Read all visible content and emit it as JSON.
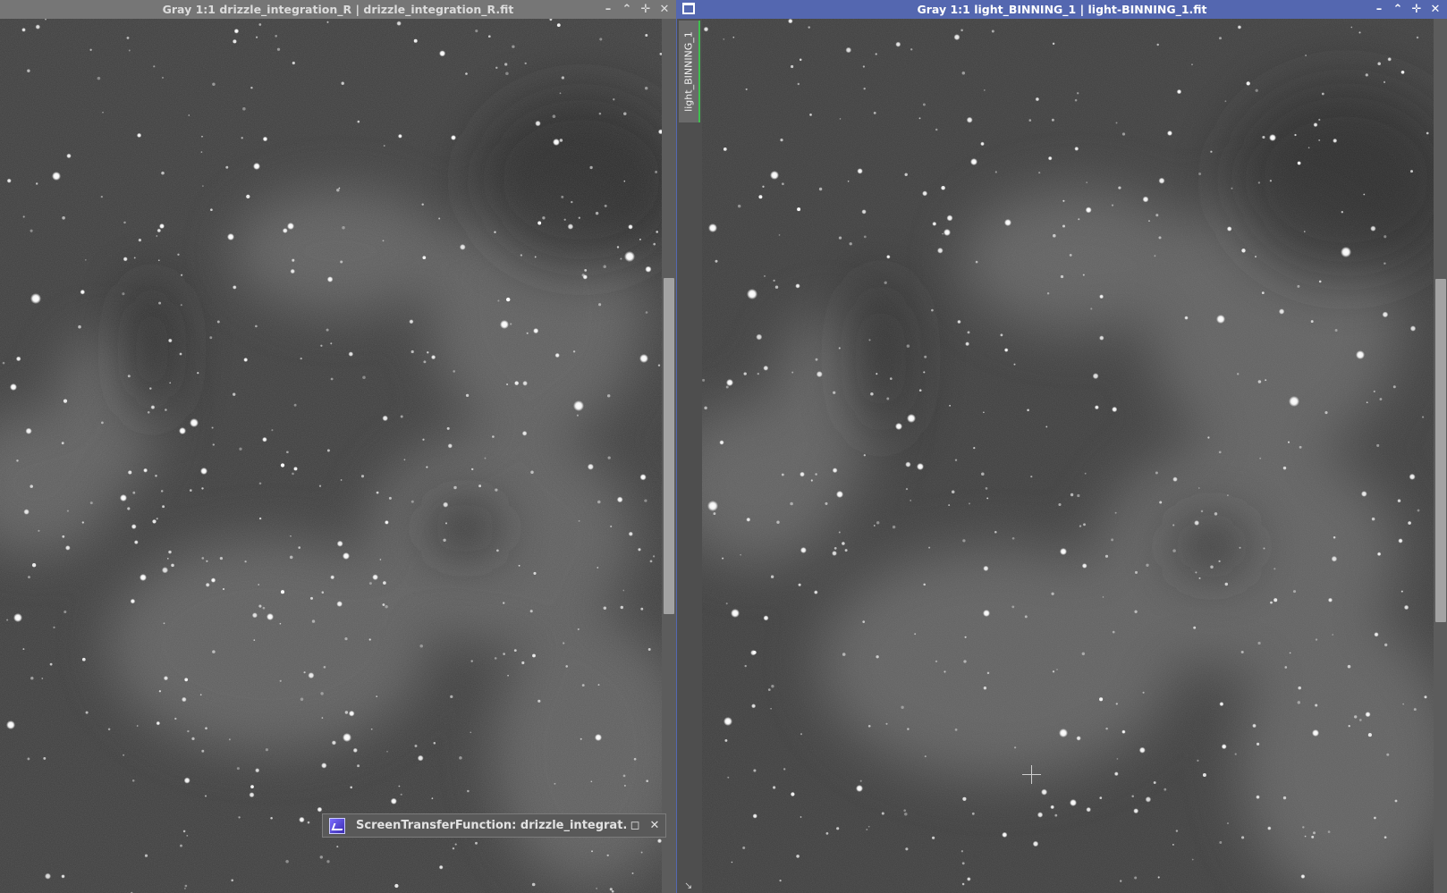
{
  "windows": {
    "left": {
      "title": "Gray 1:1 drizzle_integration_R | drizzle_integration_R.fit",
      "controls": [
        "–",
        "⌃",
        "✛",
        "✕"
      ],
      "bg": "#3a3a3a"
    },
    "right": {
      "title": "Gray 1:1 light_BINNING_1 | light-BINNING_1.fit",
      "side_tab_label": "light_BINNING_1",
      "controls": [
        "–",
        "⌃",
        "✛",
        "✕"
      ],
      "bg": "#3c3c3c",
      "accent": "#5467b0"
    }
  },
  "stf_bar": {
    "label": "ScreenTransferFunction: drizzle_integrat...",
    "controls": [
      "◻",
      "✕"
    ]
  },
  "icons": {
    "window": "window-icon",
    "minimize": "minimize-icon",
    "shade": "shade-icon",
    "maximize": "maximize-icon",
    "close": "close-icon",
    "stf": "stf-icon",
    "cursor": "crosshair-cursor"
  }
}
